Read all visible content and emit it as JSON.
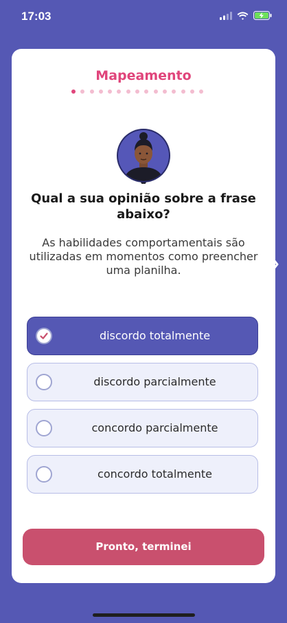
{
  "status_bar": {
    "time": "17:03"
  },
  "header": {
    "title": "Mapeamento",
    "progress_total": 15,
    "progress_current": 1
  },
  "question": {
    "title": "Qual a sua opinião sobre a frase abaixo?",
    "phrase": "As habilidades comportamentais são utilizadas em momentos como preencher uma planilha."
  },
  "options": [
    {
      "label": "discordo totalmente",
      "selected": true
    },
    {
      "label": "discordo parcialmente",
      "selected": false
    },
    {
      "label": "concordo parcialmente",
      "selected": false
    },
    {
      "label": "concordo totalmente",
      "selected": false
    }
  ],
  "submit": {
    "label": "Pronto, terminei"
  },
  "colors": {
    "background": "#5558b4",
    "accent": "#e0457b",
    "button": "#c9506e"
  }
}
